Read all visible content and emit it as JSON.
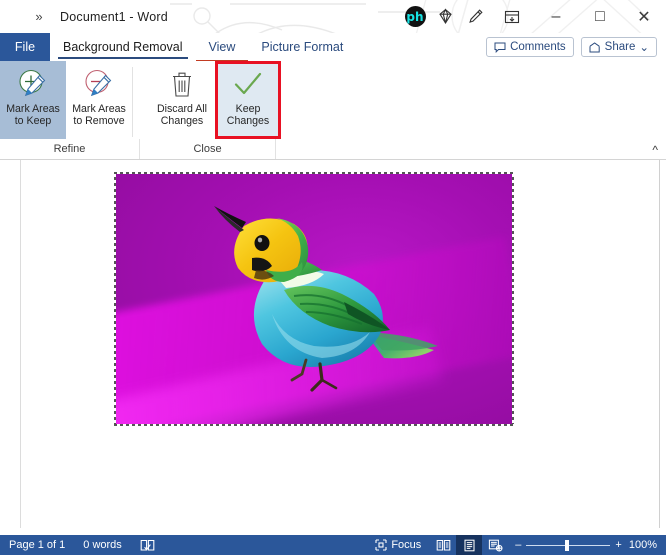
{
  "window": {
    "title": "Document1  -  Word",
    "chevrons_icon": "double-chevron-right-icon",
    "search_icon": "search-icon",
    "ph_logo_text": "ph",
    "diamond_icon": "diamond-icon",
    "pen_icon": "pen-icon",
    "ribbon_display_icon": "ribbon-display-options-icon",
    "minimize_label": "–",
    "maximize_label": "□",
    "close_label": "✕"
  },
  "tabs": {
    "file": "File",
    "items": [
      {
        "label": "Background Removal",
        "active": true
      },
      {
        "label": "View",
        "active": false
      },
      {
        "label": "Picture Format",
        "active": false
      }
    ],
    "comments": "Comments",
    "share": "Share",
    "share_caret": "⌄"
  },
  "ribbon": {
    "groups": [
      {
        "name": "Refine",
        "buttons": [
          {
            "label_line1": "Mark Areas",
            "label_line2": "to Keep",
            "icon": "mark-areas-to-keep-icon",
            "state": "selected"
          },
          {
            "label_line1": "Mark Areas",
            "label_line2": "to Remove",
            "icon": "mark-areas-to-remove-icon",
            "state": "normal"
          }
        ]
      },
      {
        "name": "Close",
        "buttons": [
          {
            "label_line1": "Discard All",
            "label_line2": "Changes",
            "icon": "trash-icon",
            "state": "normal"
          },
          {
            "label_line1": "Keep",
            "label_line2": "Changes",
            "icon": "checkmark-icon",
            "state": "highlight"
          }
        ]
      }
    ],
    "collapse_icon": "chevron-up-icon"
  },
  "document": {
    "image": {
      "alt": "colorful tanager bird perched on a branch, background marked magenta for removal",
      "background_removal_color": "#a50fb3",
      "selected": true
    }
  },
  "statusbar": {
    "page": "Page 1 of 1",
    "words": "0 words",
    "proofing_icon": "proofing-errors-icon",
    "focus_icon": "focus-mode-icon",
    "focus": "Focus",
    "views": [
      {
        "name": "read-mode",
        "icon": "read-mode-icon",
        "active": false
      },
      {
        "name": "print-layout",
        "icon": "print-layout-icon",
        "active": true
      },
      {
        "name": "web-layout",
        "icon": "web-layout-icon",
        "active": false
      }
    ],
    "zoom_out": "–",
    "zoom_in": "+",
    "zoom_value": "100%"
  },
  "colors": {
    "word_blue": "#2b579a",
    "accent_red": "#e81123",
    "selected_blue": "#a7bdd6",
    "highlight_blue": "#dfe9f2"
  }
}
